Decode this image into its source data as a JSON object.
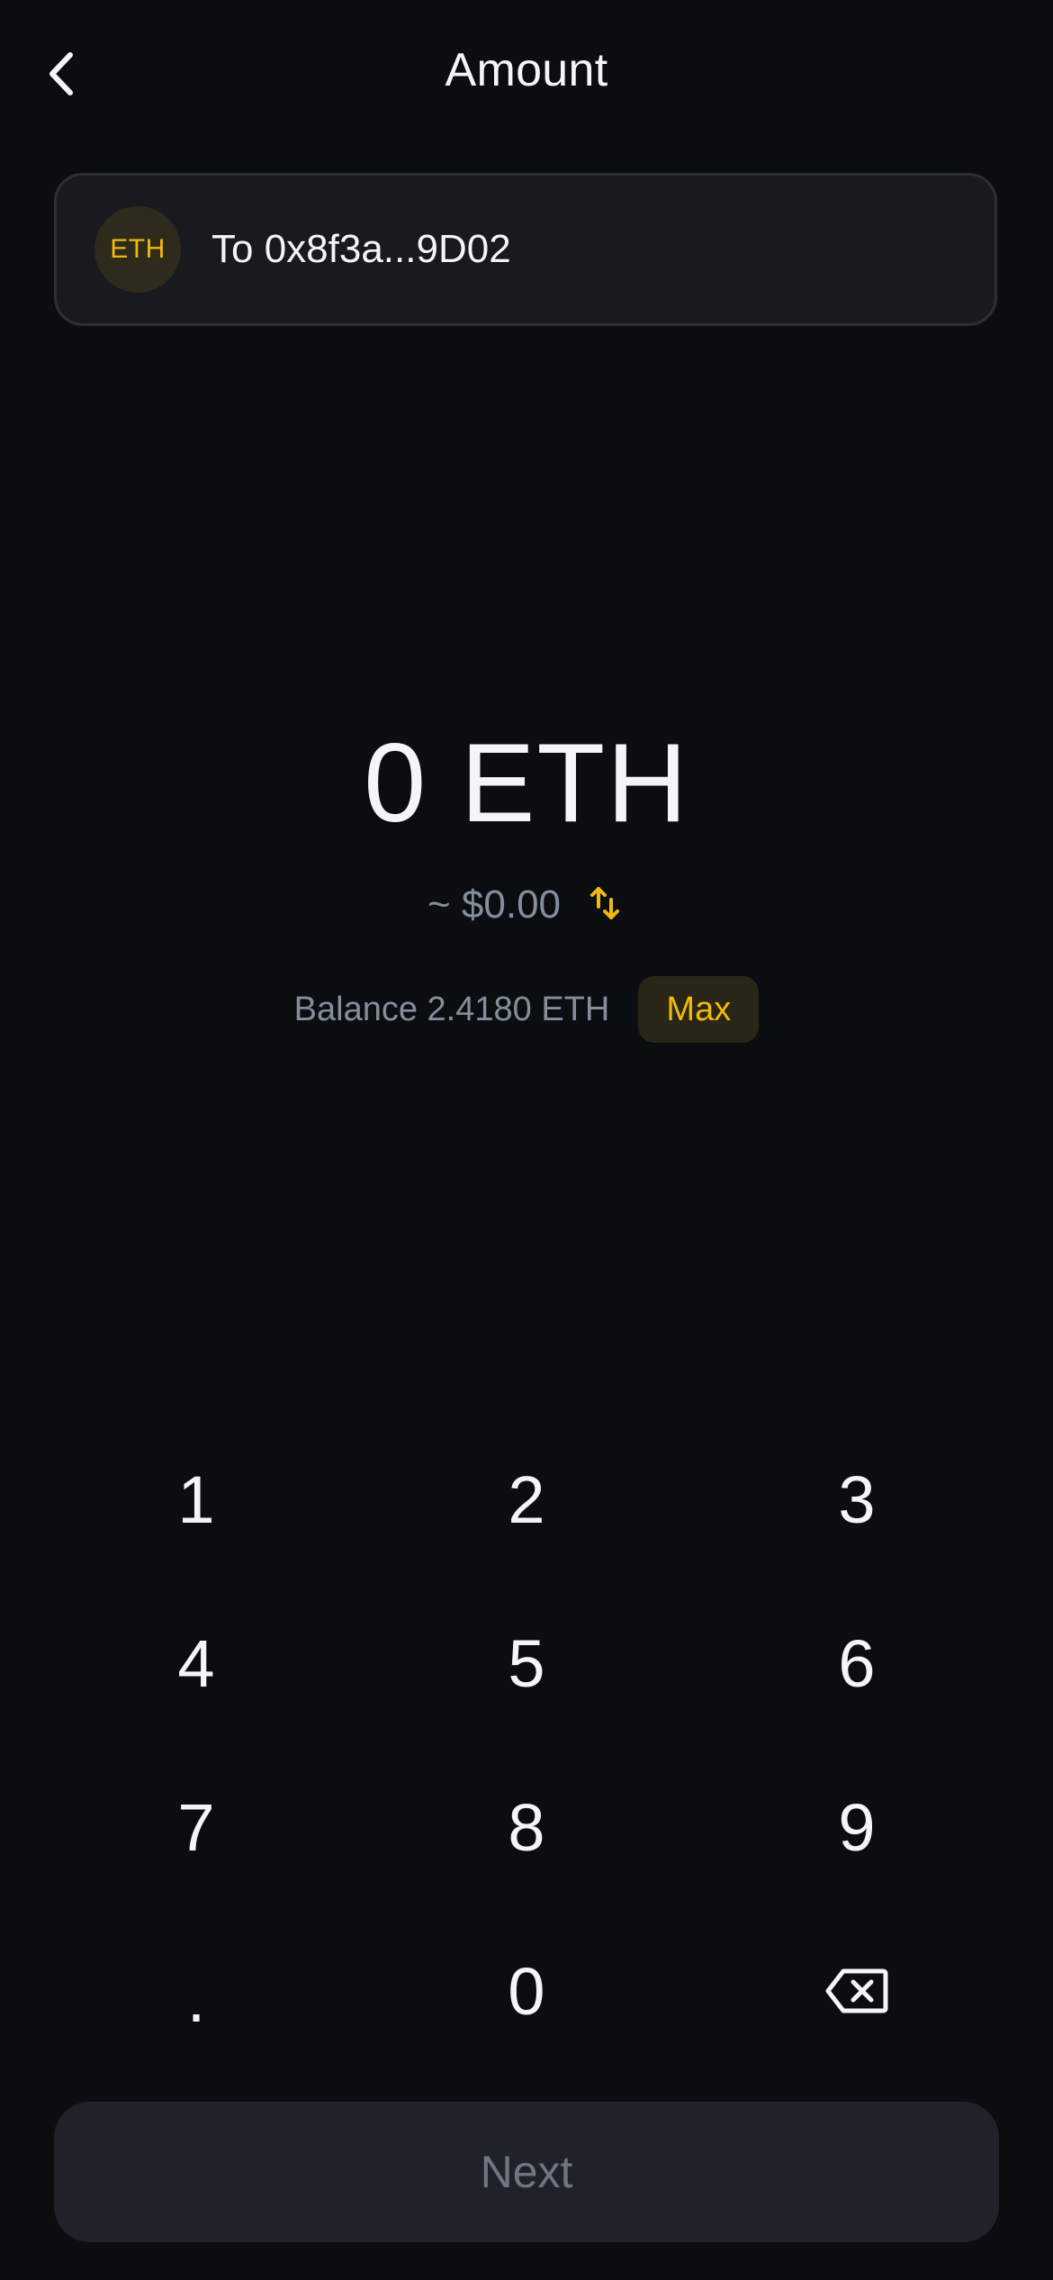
{
  "header": {
    "title": "Amount",
    "back_icon": "chevron-left-icon"
  },
  "recipient": {
    "token_badge": "ETH",
    "label": "To 0x8f3a...9D02"
  },
  "amount": {
    "value_display": "0 ETH",
    "fiat_display": "~ $0.00",
    "swap_icon": "swap-arrows-icon"
  },
  "balance": {
    "label": "Balance 2.4180 ETH",
    "max_label": "Max"
  },
  "keypad": {
    "keys": [
      "1",
      "2",
      "3",
      "4",
      "5",
      "6",
      "7",
      "8",
      "9",
      ".",
      "0"
    ],
    "backspace_icon": "backspace-icon"
  },
  "next_button": {
    "label": "Next"
  },
  "colors": {
    "background": "#0b0e11",
    "accent": "#f0b90b",
    "card": "#181a1f",
    "muted_text": "#848e9c",
    "disabled_button": "#1f2228"
  }
}
